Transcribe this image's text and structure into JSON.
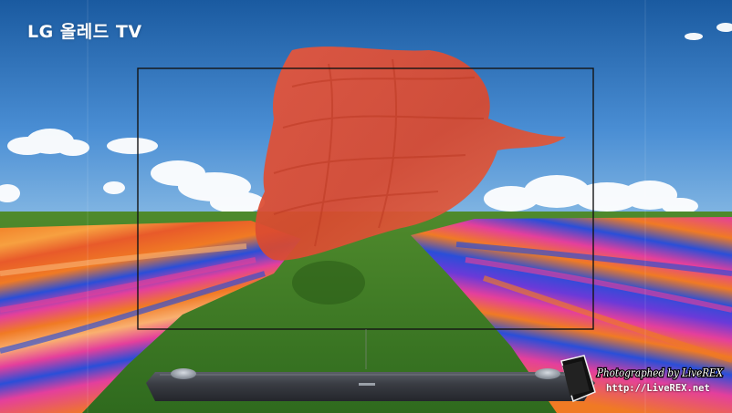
{
  "brand": {
    "text": "LG 올레드 TV"
  },
  "watermark": {
    "signature": "Photographed by LiveREX",
    "url": "http://LiveREX.net"
  },
  "colors": {
    "sky_top": "#1a5aa0",
    "sky_bottom": "#7fb3e2",
    "grass": "#3e7a28",
    "fabric_red": "#e4533a",
    "stripe_orange": "#f07a24",
    "stripe_pink": "#e43f9c",
    "stripe_blue": "#2a4ed8",
    "soundbar": "#3a3d44"
  },
  "icons": [
    "hand-icon",
    "tv-frame"
  ]
}
